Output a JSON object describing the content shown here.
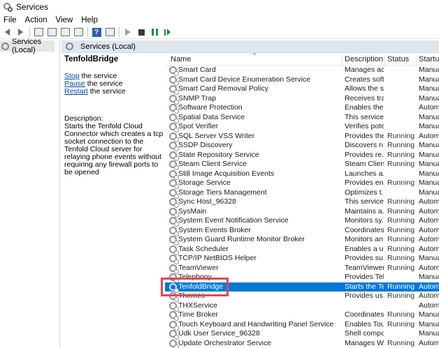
{
  "window": {
    "title": "Services"
  },
  "menu": [
    "File",
    "Action",
    "View",
    "Help"
  ],
  "tree": {
    "item": "Services (Local)"
  },
  "pane_header": {
    "title": "Services (Local)"
  },
  "description_panel": {
    "service_name": "TenfoldBridge",
    "stop_link": "Stop",
    "stop_suffix": " the service",
    "pause_link": "Pause",
    "pause_suffix": " the service",
    "restart_link": "Restart",
    "restart_suffix": " the service",
    "description_label": "Description:",
    "description_text": "Starts the Tenfold Cloud Connector which creates a tcp socket connection to the Tenfold Cloud server for relaying phone events without requiring any firewall ports to be opened"
  },
  "columns": {
    "name": "Name",
    "description": "Description",
    "status": "Status",
    "startup": "Startup"
  },
  "services": [
    {
      "name": "Smart Card",
      "description": "Manages ac...",
      "status": "",
      "startup": "Manual"
    },
    {
      "name": "Smart Card Device Enumeration Service",
      "description": "Creates soft...",
      "status": "",
      "startup": "Manual"
    },
    {
      "name": "Smart Card Removal Policy",
      "description": "Allows the s...",
      "status": "",
      "startup": "Manual"
    },
    {
      "name": "SNMP Trap",
      "description": "Receives tra...",
      "status": "",
      "startup": "Manual"
    },
    {
      "name": "Software Protection",
      "description": "Enables the ...",
      "status": "",
      "startup": "Automa"
    },
    {
      "name": "Spatial Data Service",
      "description": "This service ...",
      "status": "",
      "startup": "Manual"
    },
    {
      "name": "Spot Verifier",
      "description": "Verifies pote...",
      "status": "",
      "startup": "Manual"
    },
    {
      "name": "SQL Server VSS Writer",
      "description": "Provides the...",
      "status": "Running",
      "startup": "Automa"
    },
    {
      "name": "SSDP Discovery",
      "description": "Discovers n...",
      "status": "Running",
      "startup": "Manual"
    },
    {
      "name": "State Repository Service",
      "description": "Provides re...",
      "status": "Running",
      "startup": "Manual"
    },
    {
      "name": "Steam Client Service",
      "description": "Steam Clien...",
      "status": "Running",
      "startup": "Manual"
    },
    {
      "name": "Still Image Acquisition Events",
      "description": "Launches a...",
      "status": "",
      "startup": "Manual"
    },
    {
      "name": "Storage Service",
      "description": "Provides en...",
      "status": "Running",
      "startup": "Manual"
    },
    {
      "name": "Storage Tiers Management",
      "description": "Optimizes t...",
      "status": "",
      "startup": "Manual"
    },
    {
      "name": "Sync Host_96328",
      "description": "This service ...",
      "status": "Running",
      "startup": "Automa"
    },
    {
      "name": "SysMain",
      "description": "Maintains a...",
      "status": "Running",
      "startup": "Automa"
    },
    {
      "name": "System Event Notification Service",
      "description": "Monitors sy...",
      "status": "Running",
      "startup": "Automa"
    },
    {
      "name": "System Events Broker",
      "description": "Coordinates...",
      "status": "Running",
      "startup": "Automa"
    },
    {
      "name": "System Guard Runtime Monitor Broker",
      "description": "Monitors an...",
      "status": "Running",
      "startup": "Automa"
    },
    {
      "name": "Task Scheduler",
      "description": "Enables a u...",
      "status": "Running",
      "startup": "Automa"
    },
    {
      "name": "TCP/IP NetBIOS Helper",
      "description": "Provides su...",
      "status": "Running",
      "startup": "Manual"
    },
    {
      "name": "TeamViewer",
      "description": "TeamViewer...",
      "status": "Running",
      "startup": "Automa"
    },
    {
      "name": "Telephony",
      "description": "Provides Tel...",
      "status": "",
      "startup": "Manual"
    },
    {
      "name": "TenfoldBridge",
      "description": "Starts the Te...",
      "status": "Running",
      "startup": "Automa"
    },
    {
      "name": "Themes",
      "description": "Provides us...",
      "status": "Running",
      "startup": "Automa"
    },
    {
      "name": "THXService",
      "description": "",
      "status": "",
      "startup": "Automa"
    },
    {
      "name": "Time Broker",
      "description": "Coordinates...",
      "status": "Running",
      "startup": "Manual"
    },
    {
      "name": "Touch Keyboard and Handwriting Panel Service",
      "description": "Enables Tou...",
      "status": "Running",
      "startup": "Manual"
    },
    {
      "name": "Udk User Service_96328",
      "description": "Shell compo...",
      "status": "",
      "startup": "Manual"
    },
    {
      "name": "Update Orchestrator Service",
      "description": "Manages W...",
      "status": "Running",
      "startup": "Automa"
    }
  ],
  "selected_index": 23,
  "colors": {
    "selection": "#0078d7",
    "highlight_box": "#e8454f",
    "header": "#dfe6ee"
  }
}
